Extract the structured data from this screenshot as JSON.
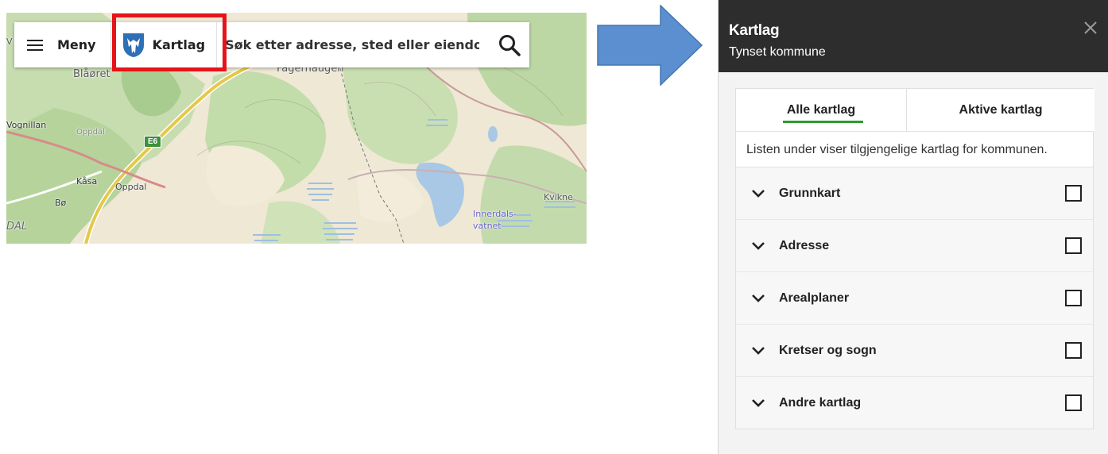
{
  "map": {
    "labels": {
      "blaoret": "Blåøret",
      "fagerhaugen": "Fagerhaugen",
      "vognillan": "Vognillan",
      "oppdal_small": "Oppdal",
      "kasa": "Kåsa",
      "oppdal": "Oppdal",
      "bo": "Bø",
      "dal": "DAL",
      "kvikne": "Kvikne",
      "innerdalsvatnet_1": "Innerdals-",
      "innerdalsvatnet_2": "vatnet",
      "road_e6": "E6",
      "edge_v": "V"
    }
  },
  "toolbar": {
    "menu_label": "Meny",
    "kartlag_label": "Kartlag",
    "search_placeholder": "Søk etter adresse, sted eller eiendom",
    "icons": [
      "hamburger-icon",
      "municipality-shield-icon",
      "search-icon"
    ]
  },
  "colors": {
    "highlight": "#e5141a",
    "arrow": "#5b8fd0",
    "panel_header": "#2d2d2d",
    "tab_underline": "#2f9a2f"
  },
  "panel": {
    "title": "Kartlag",
    "subtitle": "Tynset kommune",
    "tabs": [
      {
        "label": "Alle kartlag",
        "active": true
      },
      {
        "label": "Aktive kartlag",
        "active": false
      }
    ],
    "info": "Listen under viser tilgjengelige kartlag for kommunen.",
    "layers": [
      {
        "label": "Grunnkart",
        "checked": false
      },
      {
        "label": "Adresse",
        "checked": false
      },
      {
        "label": "Arealplaner",
        "checked": false
      },
      {
        "label": "Kretser og sogn",
        "checked": false
      },
      {
        "label": "Andre kartlag",
        "checked": false
      }
    ]
  }
}
